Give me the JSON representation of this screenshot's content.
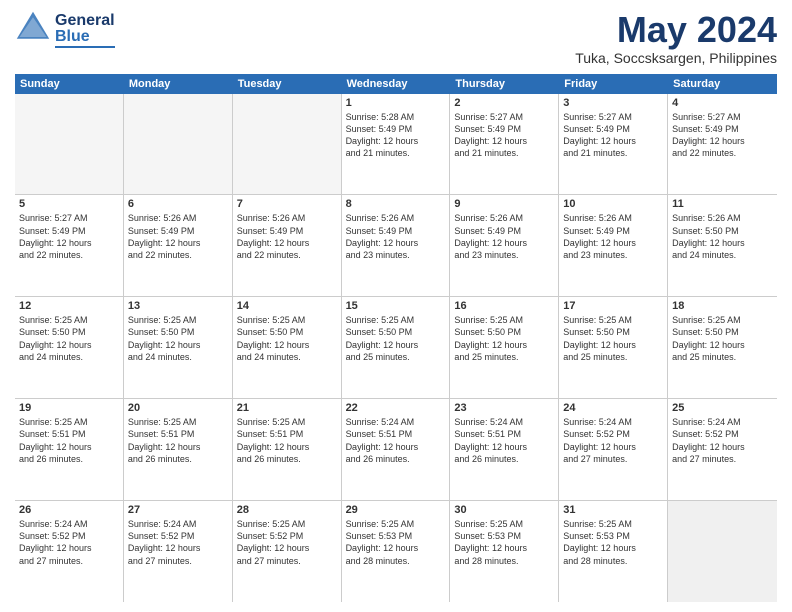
{
  "header": {
    "logo": {
      "general": "General",
      "blue": "Blue"
    },
    "title": "May 2024",
    "subtitle": "Tuka, Soccsksargen, Philippines"
  },
  "calendar": {
    "days_of_week": [
      "Sunday",
      "Monday",
      "Tuesday",
      "Wednesday",
      "Thursday",
      "Friday",
      "Saturday"
    ],
    "accent_color": "#2a6db5",
    "weeks": [
      [
        {
          "day": "",
          "info": "",
          "empty": true
        },
        {
          "day": "",
          "info": "",
          "empty": true
        },
        {
          "day": "",
          "info": "",
          "empty": true
        },
        {
          "day": "1",
          "info": "Sunrise: 5:28 AM\nSunset: 5:49 PM\nDaylight: 12 hours\nand 21 minutes.",
          "empty": false
        },
        {
          "day": "2",
          "info": "Sunrise: 5:27 AM\nSunset: 5:49 PM\nDaylight: 12 hours\nand 21 minutes.",
          "empty": false
        },
        {
          "day": "3",
          "info": "Sunrise: 5:27 AM\nSunset: 5:49 PM\nDaylight: 12 hours\nand 21 minutes.",
          "empty": false
        },
        {
          "day": "4",
          "info": "Sunrise: 5:27 AM\nSunset: 5:49 PM\nDaylight: 12 hours\nand 22 minutes.",
          "empty": false
        }
      ],
      [
        {
          "day": "5",
          "info": "Sunrise: 5:27 AM\nSunset: 5:49 PM\nDaylight: 12 hours\nand 22 minutes.",
          "empty": false
        },
        {
          "day": "6",
          "info": "Sunrise: 5:26 AM\nSunset: 5:49 PM\nDaylight: 12 hours\nand 22 minutes.",
          "empty": false
        },
        {
          "day": "7",
          "info": "Sunrise: 5:26 AM\nSunset: 5:49 PM\nDaylight: 12 hours\nand 22 minutes.",
          "empty": false
        },
        {
          "day": "8",
          "info": "Sunrise: 5:26 AM\nSunset: 5:49 PM\nDaylight: 12 hours\nand 23 minutes.",
          "empty": false
        },
        {
          "day": "9",
          "info": "Sunrise: 5:26 AM\nSunset: 5:49 PM\nDaylight: 12 hours\nand 23 minutes.",
          "empty": false
        },
        {
          "day": "10",
          "info": "Sunrise: 5:26 AM\nSunset: 5:49 PM\nDaylight: 12 hours\nand 23 minutes.",
          "empty": false
        },
        {
          "day": "11",
          "info": "Sunrise: 5:26 AM\nSunset: 5:50 PM\nDaylight: 12 hours\nand 24 minutes.",
          "empty": false
        }
      ],
      [
        {
          "day": "12",
          "info": "Sunrise: 5:25 AM\nSunset: 5:50 PM\nDaylight: 12 hours\nand 24 minutes.",
          "empty": false
        },
        {
          "day": "13",
          "info": "Sunrise: 5:25 AM\nSunset: 5:50 PM\nDaylight: 12 hours\nand 24 minutes.",
          "empty": false
        },
        {
          "day": "14",
          "info": "Sunrise: 5:25 AM\nSunset: 5:50 PM\nDaylight: 12 hours\nand 24 minutes.",
          "empty": false
        },
        {
          "day": "15",
          "info": "Sunrise: 5:25 AM\nSunset: 5:50 PM\nDaylight: 12 hours\nand 25 minutes.",
          "empty": false
        },
        {
          "day": "16",
          "info": "Sunrise: 5:25 AM\nSunset: 5:50 PM\nDaylight: 12 hours\nand 25 minutes.",
          "empty": false
        },
        {
          "day": "17",
          "info": "Sunrise: 5:25 AM\nSunset: 5:50 PM\nDaylight: 12 hours\nand 25 minutes.",
          "empty": false
        },
        {
          "day": "18",
          "info": "Sunrise: 5:25 AM\nSunset: 5:50 PM\nDaylight: 12 hours\nand 25 minutes.",
          "empty": false
        }
      ],
      [
        {
          "day": "19",
          "info": "Sunrise: 5:25 AM\nSunset: 5:51 PM\nDaylight: 12 hours\nand 26 minutes.",
          "empty": false
        },
        {
          "day": "20",
          "info": "Sunrise: 5:25 AM\nSunset: 5:51 PM\nDaylight: 12 hours\nand 26 minutes.",
          "empty": false
        },
        {
          "day": "21",
          "info": "Sunrise: 5:25 AM\nSunset: 5:51 PM\nDaylight: 12 hours\nand 26 minutes.",
          "empty": false
        },
        {
          "day": "22",
          "info": "Sunrise: 5:24 AM\nSunset: 5:51 PM\nDaylight: 12 hours\nand 26 minutes.",
          "empty": false
        },
        {
          "day": "23",
          "info": "Sunrise: 5:24 AM\nSunset: 5:51 PM\nDaylight: 12 hours\nand 26 minutes.",
          "empty": false
        },
        {
          "day": "24",
          "info": "Sunrise: 5:24 AM\nSunset: 5:52 PM\nDaylight: 12 hours\nand 27 minutes.",
          "empty": false
        },
        {
          "day": "25",
          "info": "Sunrise: 5:24 AM\nSunset: 5:52 PM\nDaylight: 12 hours\nand 27 minutes.",
          "empty": false
        }
      ],
      [
        {
          "day": "26",
          "info": "Sunrise: 5:24 AM\nSunset: 5:52 PM\nDaylight: 12 hours\nand 27 minutes.",
          "empty": false
        },
        {
          "day": "27",
          "info": "Sunrise: 5:24 AM\nSunset: 5:52 PM\nDaylight: 12 hours\nand 27 minutes.",
          "empty": false
        },
        {
          "day": "28",
          "info": "Sunrise: 5:25 AM\nSunset: 5:52 PM\nDaylight: 12 hours\nand 27 minutes.",
          "empty": false
        },
        {
          "day": "29",
          "info": "Sunrise: 5:25 AM\nSunset: 5:53 PM\nDaylight: 12 hours\nand 28 minutes.",
          "empty": false
        },
        {
          "day": "30",
          "info": "Sunrise: 5:25 AM\nSunset: 5:53 PM\nDaylight: 12 hours\nand 28 minutes.",
          "empty": false
        },
        {
          "day": "31",
          "info": "Sunrise: 5:25 AM\nSunset: 5:53 PM\nDaylight: 12 hours\nand 28 minutes.",
          "empty": false
        },
        {
          "day": "",
          "info": "",
          "empty": true
        }
      ]
    ]
  }
}
